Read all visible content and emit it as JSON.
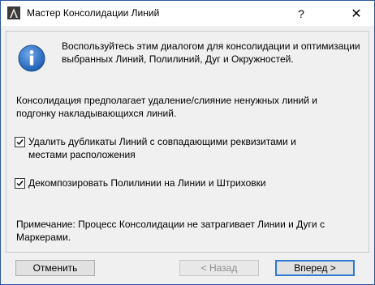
{
  "window": {
    "title": "Мастер Консолидации Линий",
    "help_label": "?",
    "close_label": "✕"
  },
  "content": {
    "intro": "Воспользуйтесь этим диалогом для консолидации и оптимизации выбранных Линий, Полилиний, Дуг и Окружностей.",
    "description": "Консолидация предполагает удаление/слияние ненужных линий и подгонку накладывающихся линий.",
    "options": [
      {
        "label": "Удалить дубликаты Линий с совпадающими реквизитами и местами расположения",
        "checked": true
      },
      {
        "label": "Декомпозировать Полилинии на Линии и Штриховки",
        "checked": true
      }
    ],
    "note": "Примечание: Процесс Консолидации не затрагивает Линии и Дуги с Маркерами."
  },
  "footer": {
    "cancel_label": "Отменить",
    "back_label": "< Назад",
    "next_label": "Вперед >"
  },
  "colors": {
    "info_blue": "#1f5fb4",
    "accent": "#2a7ad4"
  }
}
